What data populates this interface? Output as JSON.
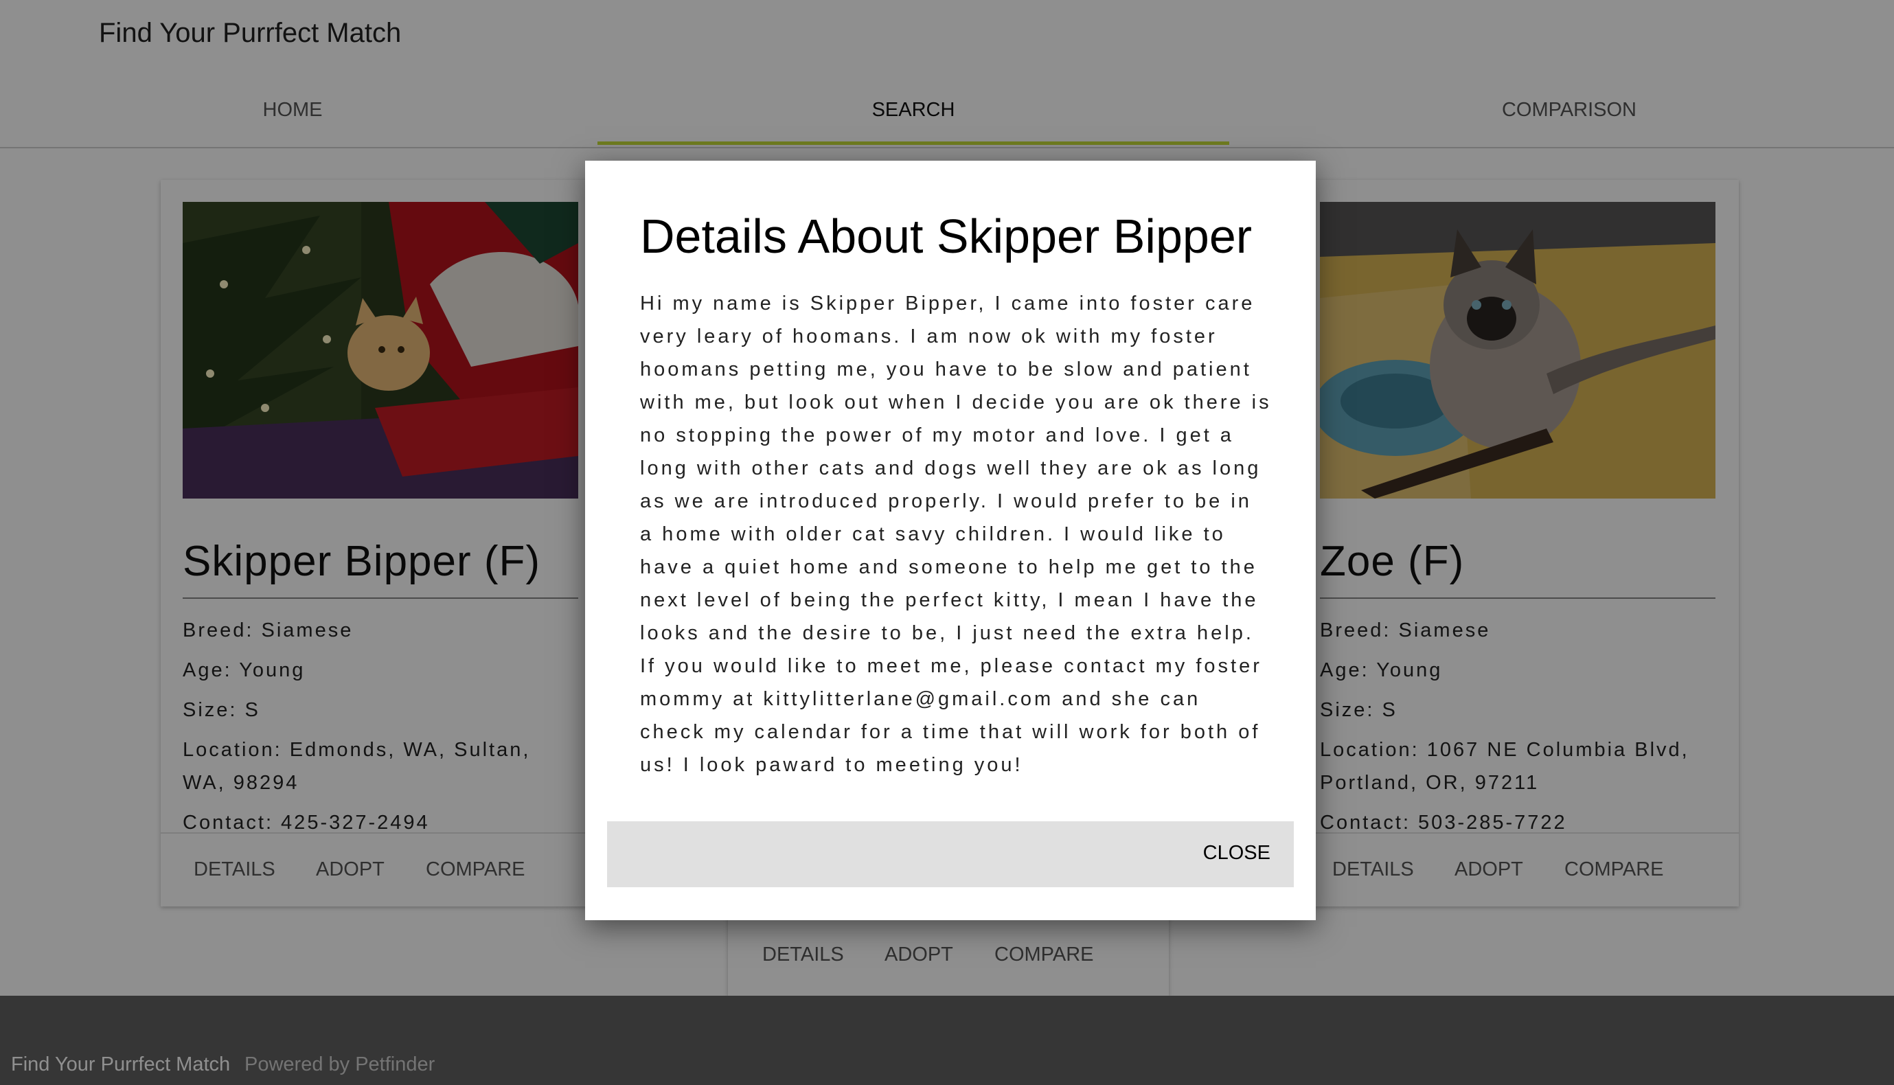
{
  "header": {
    "brand": "Find Your Purrfect Match",
    "tabs": [
      {
        "label": "HOME"
      },
      {
        "label": "SEARCH"
      },
      {
        "label": "COMPARISON"
      }
    ],
    "active_tab": "SEARCH",
    "accent_color": "#c6de3a"
  },
  "cards": [
    {
      "name": "Skipper Bipper (F)",
      "breed": "Breed: Siamese",
      "age": "Age: Young",
      "size": "Size: S",
      "location": "Location: Edmonds, WA, Sultan, WA, 98294",
      "contact": "Contact: 425-327-2494",
      "actions": {
        "details": "DETAILS",
        "adopt": "ADOPT",
        "compare": "COMPARE"
      }
    },
    {
      "name": "Zoe (F)",
      "breed": "Breed: Siamese",
      "age": "Age: Young",
      "size": "Size: S",
      "location": "Location: 1067 NE Columbia Blvd, Portland, OR, 97211",
      "contact": "Contact: 503-285-7722",
      "actions": {
        "details": "DETAILS",
        "adopt": "ADOPT",
        "compare": "COMPARE"
      }
    }
  ],
  "middle_card_actions": {
    "details": "DETAILS",
    "adopt": "ADOPT",
    "compare": "COMPARE"
  },
  "modal": {
    "title": "Details About Skipper Bipper",
    "body": "Hi my name is Skipper Bipper, I came into foster care very leary of hoomans. I am now ok with my foster hoomans petting me, you have to be slow and patient with me, but look out when I decide you are ok there is no stopping the power of my motor and love. I get a long with other cats and dogs well they are ok as long as we are introduced properly. I would prefer to be in a home with older cat savy children. I would like to have a quiet home and someone to help me get to the next level of being the perfect kitty, I mean I have the looks and the desire to be, I just need the extra help. If you would like to meet me, please contact my foster mommy at kittylitterlane@gmail.com and she can check my calendar for a time that will work for both of us! I look paward to meeting you!",
    "close_label": "CLOSE"
  },
  "footer": {
    "brand": "Find Your Purrfect Match",
    "powered": "Powered by Petfinder"
  }
}
